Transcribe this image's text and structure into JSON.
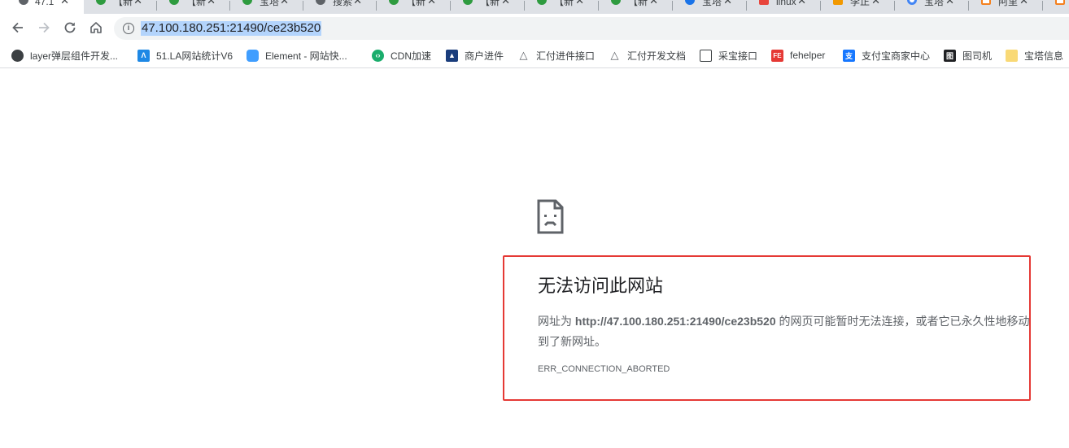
{
  "tabs": [
    {
      "title": "47.1",
      "icon": "gray",
      "active": true
    },
    {
      "title": "【新",
      "icon": "green"
    },
    {
      "title": "【新",
      "icon": "green"
    },
    {
      "title": "宝塔",
      "icon": "green"
    },
    {
      "title": "搜索",
      "icon": "gray"
    },
    {
      "title": "【新",
      "icon": "green"
    },
    {
      "title": "【新",
      "icon": "green"
    },
    {
      "title": "【新",
      "icon": "green"
    },
    {
      "title": "【新",
      "icon": "green"
    },
    {
      "title": "宝塔",
      "icon": "shield"
    },
    {
      "title": "linux",
      "icon": "red"
    },
    {
      "title": "李正",
      "icon": "orange"
    },
    {
      "title": "宝塔",
      "icon": "ring"
    },
    {
      "title": "阿里",
      "icon": "orange2"
    },
    {
      "title": "",
      "icon": "orange2"
    }
  ],
  "toolbar": {
    "url": "47.100.180.251:21490/ce23b520"
  },
  "bookmarks": [
    {
      "label": "layer弹层组件开发...",
      "icon": "layer-icon"
    },
    {
      "label": "51.LA网站统计V6",
      "icon": "la-icon"
    },
    {
      "label": "Element - 网站快...",
      "icon": "element-icon"
    },
    {
      "label": "CDN加速",
      "icon": "cdn-icon"
    },
    {
      "label": "商户进件",
      "icon": "merchant-icon"
    },
    {
      "label": "汇付进件接口",
      "icon": "huifu-icon"
    },
    {
      "label": "汇付开发文档",
      "icon": "huifu-icon"
    },
    {
      "label": "采宝接口",
      "icon": "book-icon"
    },
    {
      "label": "fehelper",
      "icon": "fehelper-icon"
    },
    {
      "label": "支付宝商家中心",
      "icon": "alipay-icon"
    },
    {
      "label": "图司机",
      "icon": "tusiji-icon"
    },
    {
      "label": "宝塔信息",
      "icon": "folder-icon"
    }
  ],
  "error": {
    "title": "无法访问此网站",
    "desc_prefix": "网址为 ",
    "desc_url": "http://47.100.180.251:21490/ce23b520",
    "desc_suffix": " 的网页可能暂时无法连接，或者它已永久性地移动到了新网址。",
    "code": "ERR_CONNECTION_ABORTED"
  }
}
